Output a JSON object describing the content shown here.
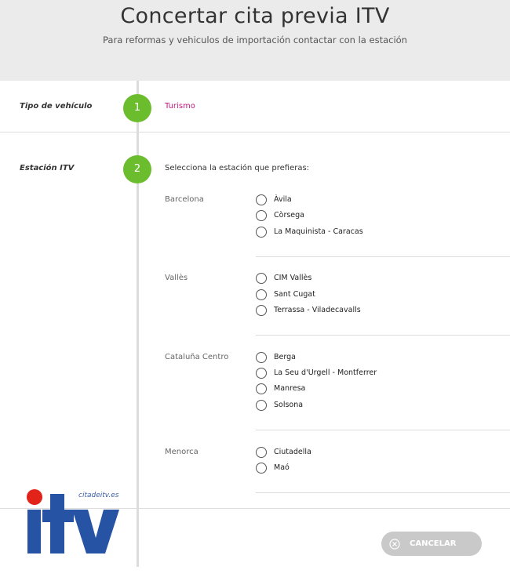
{
  "header": {
    "title": "Concertar cita previa ITV",
    "subtitle": "Para reformas y vehiculos de importación contactar con la estación"
  },
  "steps": [
    {
      "number": "1",
      "label": "Tipo de vehículo",
      "value": "Turismo"
    },
    {
      "number": "2",
      "label": "Estación ITV",
      "prompt": "Selecciona la estación que prefieras:"
    }
  ],
  "regions": [
    {
      "name": "Barcelona",
      "stations": [
        "Àvila",
        "Còrsega",
        "La Maquinista - Caracas"
      ]
    },
    {
      "name": "Vallès",
      "stations": [
        "CIM Vallès",
        "Sant Cugat",
        "Terrassa - Viladecavalls"
      ]
    },
    {
      "name": "Cataluña Centro",
      "stations": [
        "Berga",
        "La Seu d'Urgell - Montferrer",
        "Manresa",
        "Solsona"
      ]
    },
    {
      "name": "Menorca",
      "stations": [
        "Ciutadella",
        "Maó"
      ]
    }
  ],
  "logo": {
    "site": "citadeitv.es",
    "text": "itv"
  },
  "actions": {
    "cancel_label": "CANCELAR",
    "cancel_icon": "close-circle-icon"
  },
  "colors": {
    "step_circle": "#6cbd2e",
    "vehicle_value": "#c3197d",
    "logo_blue": "#2753a4",
    "logo_red": "#e2231a"
  }
}
